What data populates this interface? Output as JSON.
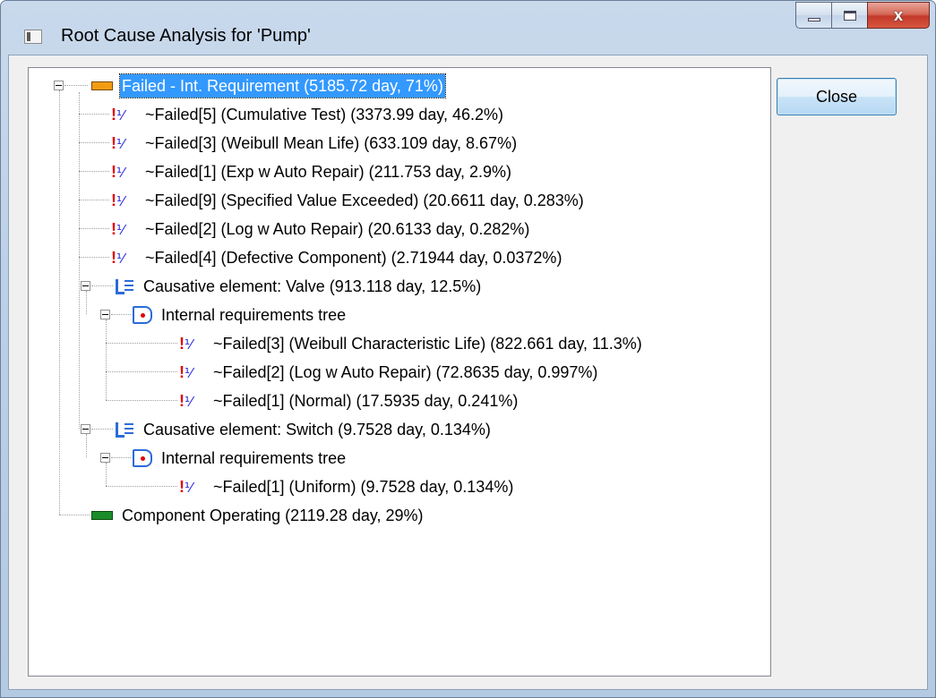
{
  "window": {
    "title": "Root Cause Analysis for 'Pump'",
    "close_label": "Close",
    "controls": {
      "minimize_icon": "minimize-icon",
      "maximize_icon": "maximize-icon",
      "close_icon": "close-icon",
      "close_glyph": "x"
    }
  },
  "colors": {
    "selection": "#3399ff",
    "failed_state": "#f39c12",
    "operating_state": "#1c8c2a",
    "failure_mark": "#e00000",
    "element_icon": "#2b6cd8"
  },
  "tree": {
    "nodes": [
      {
        "type": "state-failed",
        "icon": "orange-state-icon",
        "label": "Failed - Int. Requirement (5185.72 day, 71%)",
        "selected": true,
        "expanded": true
      },
      {
        "type": "failure",
        "icon": "failure-mode-icon",
        "label": "~Failed[5]  (Cumulative Test) (3373.99 day, 46.2%)"
      },
      {
        "type": "failure",
        "icon": "failure-mode-icon",
        "label": "~Failed[3]  (Weibull Mean Life) (633.109 day, 8.67%)"
      },
      {
        "type": "failure",
        "icon": "failure-mode-icon",
        "label": "~Failed[1]  (Exp w Auto Repair) (211.753 day, 2.9%)"
      },
      {
        "type": "failure",
        "icon": "failure-mode-icon",
        "label": "~Failed[9]  (Specified Value Exceeded) (20.6611 day, 0.283%)"
      },
      {
        "type": "failure",
        "icon": "failure-mode-icon",
        "label": "~Failed[2]  (Log w Auto Repair) (20.6133 day, 0.282%)"
      },
      {
        "type": "failure",
        "icon": "failure-mode-icon",
        "label": "~Failed[4]  (Defective Component) (2.71944 day, 0.0372%)"
      },
      {
        "type": "causative",
        "icon": "causative-element-icon",
        "label": "Causative element: Valve (913.118 day, 12.5%)",
        "expanded": true
      },
      {
        "type": "requirements",
        "icon": "requirements-tree-icon",
        "label": "Internal requirements tree",
        "expanded": true
      },
      {
        "type": "failure",
        "icon": "failure-mode-icon",
        "label": "~Failed[3]  (Weibull Characteristic Life) (822.661 day, 11.3%)"
      },
      {
        "type": "failure",
        "icon": "failure-mode-icon",
        "label": "~Failed[2]  (Log w Auto Repair) (72.8635 day, 0.997%)"
      },
      {
        "type": "failure",
        "icon": "failure-mode-icon",
        "label": "~Failed[1]  (Normal) (17.5935 day, 0.241%)"
      },
      {
        "type": "causative",
        "icon": "causative-element-icon",
        "label": "Causative element: Switch (9.7528 day, 0.134%)",
        "expanded": true
      },
      {
        "type": "requirements",
        "icon": "requirements-tree-icon",
        "label": "Internal requirements tree",
        "expanded": true
      },
      {
        "type": "failure",
        "icon": "failure-mode-icon",
        "label": "~Failed[1]  (Uniform) (9.7528 day, 0.134%)"
      },
      {
        "type": "state-operating",
        "icon": "green-state-icon",
        "label": "Component Operating (2119.28 day, 29%)"
      }
    ]
  }
}
